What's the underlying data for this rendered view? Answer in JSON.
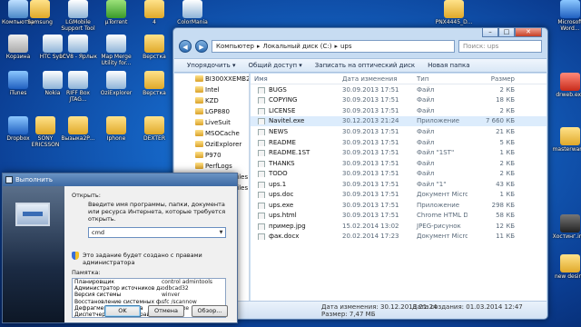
{
  "desktop": {
    "icons": [
      {
        "label": "Компьютер",
        "icon": "computer-icon"
      },
      {
        "label": "Samsung",
        "icon": "folder-icon"
      },
      {
        "label": "LGMobile Support Tool",
        "icon": "app-icon"
      },
      {
        "label": "µTorrent",
        "icon": "torrent-icon"
      },
      {
        "label": "4",
        "icon": "folder-icon"
      },
      {
        "label": "ColorMania",
        "icon": "app-icon"
      },
      {
        "label": "PNX4445_D...",
        "icon": "folder-icon"
      },
      {
        "label": "Корзина",
        "icon": "recycle-bin-icon"
      },
      {
        "label": "HTC Sync",
        "icon": "app-icon"
      },
      {
        "label": "1СV8 - Ярлык",
        "icon": "app-icon"
      },
      {
        "label": "Map Merge Utility for...",
        "icon": "app-icon"
      },
      {
        "label": "Верстка",
        "icon": "folder-icon"
      },
      {
        "label": "iTunes",
        "icon": "itunes-icon"
      },
      {
        "label": "Nokia",
        "icon": "app-icon"
      },
      {
        "label": "RIFF Box JTAG...",
        "icon": "app-icon"
      },
      {
        "label": "OziExplorer",
        "icon": "app-icon"
      },
      {
        "label": "Верстка",
        "icon": "folder-icon"
      },
      {
        "label": "Dropbox",
        "icon": "dropbox-icon"
      },
      {
        "label": "SONY ERICSSON",
        "icon": "folder-icon"
      },
      {
        "label": "Вызыка2Р...",
        "icon": "folder-icon"
      },
      {
        "label": "Iphone",
        "icon": "folder-icon"
      },
      {
        "label": "DEXTER",
        "icon": "folder-icon"
      },
      {
        "label": "drweb.exe",
        "icon": "drweb-icon"
      },
      {
        "label": "Microsoft Word...",
        "icon": "word-icon"
      },
      {
        "label": "masterwares",
        "icon": "folder-icon"
      },
      {
        "label": "new desine",
        "icon": "folder-icon"
      },
      {
        "label": "Хостинг.img",
        "icon": "image-file-icon"
      }
    ]
  },
  "explorer": {
    "breadcrumb": [
      "Компьютер",
      "Локальный диск (C:)",
      "ups"
    ],
    "search_placeholder": "Поиск: ups",
    "toolbar": {
      "organize": "Упорядочить ▾",
      "share": "Общий доступ ▾",
      "burn": "Записать на оптический диск",
      "new_folder": "Новая папка"
    },
    "nav_items": [
      "BI300XXEMB2",
      "Intel",
      "KZD",
      "LGP880",
      "LiveSuit",
      "MSOCache",
      "OziExplorer",
      "P970",
      "PerfLogs",
      "Program Files",
      "Program Files (x86"
    ],
    "columns": {
      "name": "Имя",
      "date": "Дата изменения",
      "type": "Тип",
      "size": "Размер"
    },
    "files": [
      {
        "name": "BUGS",
        "date": "30.09.2013 17:51",
        "type": "Файл",
        "size": "2 КБ"
      },
      {
        "name": "COPYING",
        "date": "30.09.2013 17:51",
        "type": "Файл",
        "size": "18 КБ"
      },
      {
        "name": "LICENSE",
        "date": "30.09.2013 17:51",
        "type": "Файл",
        "size": "2 КБ"
      },
      {
        "name": "Navitel.exe",
        "date": "30.12.2013 21:24",
        "type": "Приложение",
        "size": "7 660 КБ"
      },
      {
        "name": "NEWS",
        "date": "30.09.2013 17:51",
        "type": "Файл",
        "size": "21 КБ"
      },
      {
        "name": "README",
        "date": "30.09.2013 17:51",
        "type": "Файл",
        "size": "5 КБ"
      },
      {
        "name": "README.1ST",
        "date": "30.09.2013 17:51",
        "type": "Файл \"1ST\"",
        "size": "1 КБ"
      },
      {
        "name": "THANKS",
        "date": "30.09.2013 17:51",
        "type": "Файл",
        "size": "2 КБ"
      },
      {
        "name": "TODO",
        "date": "30.09.2013 17:51",
        "type": "Файл",
        "size": "2 КБ"
      },
      {
        "name": "ups.1",
        "date": "30.09.2013 17:51",
        "type": "Файл \"1\"",
        "size": "43 КБ"
      },
      {
        "name": "ups.doc",
        "date": "30.09.2013 17:51",
        "type": "Документ Micros...",
        "size": "1 КБ"
      },
      {
        "name": "ups.exe",
        "date": "30.09.2013 17:51",
        "type": "Приложение",
        "size": "298 КБ"
      },
      {
        "name": "ups.html",
        "date": "30.09.2013 17:51",
        "type": "Chrome HTML Do...",
        "size": "58 КБ"
      },
      {
        "name": "пример.jpg",
        "date": "15.02.2014 13:02",
        "type": "JPEG-рисунок",
        "size": "12 КБ"
      },
      {
        "name": "фак.docx",
        "date": "20.02.2014 17:23",
        "type": "Документ Micros...",
        "size": "11 КБ"
      }
    ],
    "status": {
      "created_label": "Дата изменения: 30.12.2013 21:24",
      "created2": "Дата создания: 01.03.2014 12:47",
      "size": "Размер: 7,47 МБ"
    }
  },
  "run_dialog": {
    "title": "Выполнить",
    "open_label": "Открыть:",
    "description": "Введите имя программы, папки, документа или ресурса Интернета, которые требуется открыть.",
    "input_value": "cmd",
    "admin_note": "Это задание будет создано с правами администратора",
    "memo_label": "Памятка:",
    "memo_rows": [
      {
        "name": "Планировщик",
        "cmd": "control admintools"
      },
      {
        "name": "Администратор источников данных",
        "cmd": "odbcad32"
      },
      {
        "name": "Версия системы",
        "cmd": "winver"
      },
      {
        "name": "Восстановление системных файлов",
        "cmd": "sfc /scannow"
      },
      {
        "name": "Дефрагментация диска",
        "cmd": "dfrgui.exe"
      },
      {
        "name": "Диспетчер проверки драйверов",
        "cmd": "verifier"
      }
    ],
    "buttons": {
      "ok": "OK",
      "cancel": "Отмена",
      "browse": "Обзор..."
    }
  }
}
